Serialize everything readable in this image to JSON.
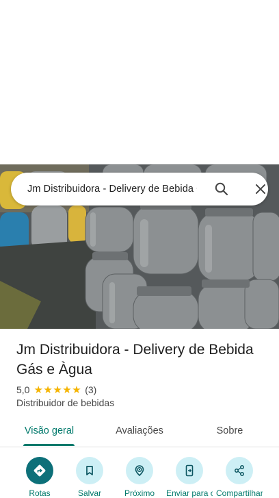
{
  "search": {
    "query": "Jm Distribuidora - Delivery de Bebida Gás e Àgua"
  },
  "place": {
    "name": "Jm Distribuidora - Delivery de Bebida Gás e Àgua",
    "rating": "5,0",
    "stars": "★★★★★",
    "review_count": "(3)",
    "category": "Distribuidor de bebidas"
  },
  "tabs": [
    {
      "label": "Visão geral",
      "active": true
    },
    {
      "label": "Avaliações",
      "active": false
    },
    {
      "label": "Sobre",
      "active": false
    }
  ],
  "actions": [
    {
      "label": "Rotas",
      "icon": "directions-icon"
    },
    {
      "label": "Salvar",
      "icon": "bookmark-icon"
    },
    {
      "label": "Próximo",
      "icon": "nearby-icon"
    },
    {
      "label": "Enviar para o smartphone",
      "icon": "send-to-phone-icon"
    },
    {
      "label": "Compartilhar",
      "icon": "share-icon"
    }
  ],
  "colors": {
    "accent": "#00796b",
    "primary_action": "#0d7079",
    "action_bg": "#cdeff5",
    "star": "#f5b400"
  }
}
